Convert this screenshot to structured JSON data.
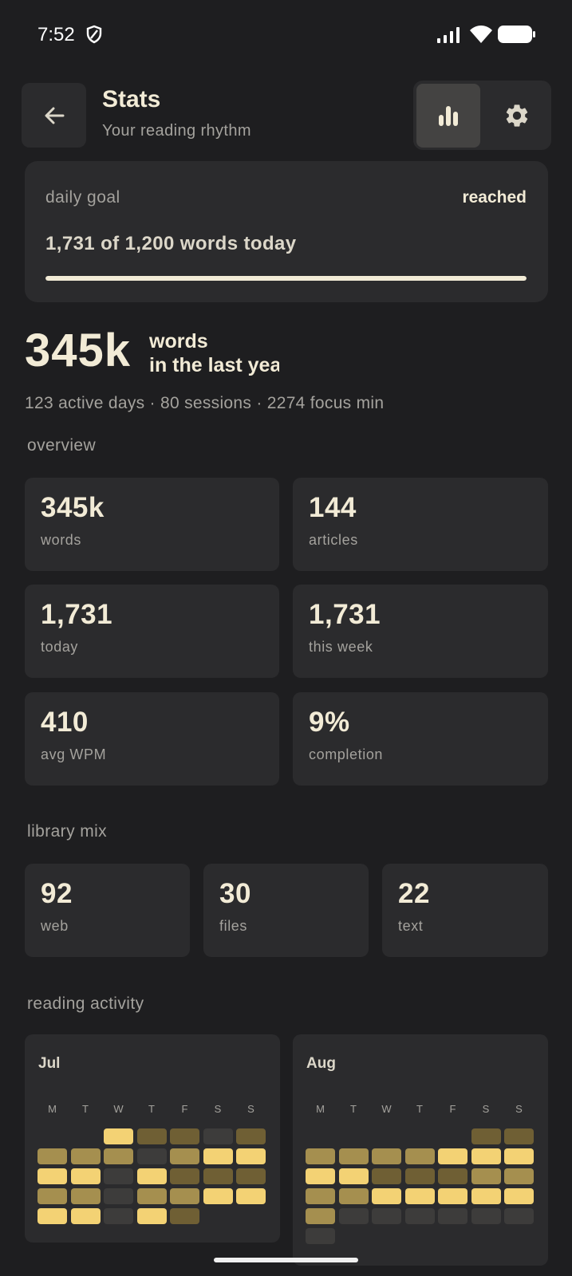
{
  "status_bar": {
    "time": "7:52"
  },
  "header": {
    "title": "Stats",
    "subtitle": "Your reading rhythm"
  },
  "goal": {
    "label": "daily goal",
    "status": "reached",
    "text": "1,731 of 1,200 words today",
    "progress": 1.0
  },
  "totals": {
    "value": "345k",
    "unit": "words",
    "period": "in the last year",
    "summary": "123 active days · 80 sessions · 2274 focus min"
  },
  "overview": {
    "label": "overview",
    "cards": [
      {
        "value": "345k",
        "label": "words"
      },
      {
        "value": "144",
        "label": "articles"
      },
      {
        "value": "1,731",
        "label": "today"
      },
      {
        "value": "1,731",
        "label": "this week"
      },
      {
        "value": "410",
        "label": "avg WPM"
      },
      {
        "value": "9%",
        "label": "completion"
      }
    ]
  },
  "library": {
    "label": "library mix",
    "cards": [
      {
        "value": "92",
        "label": "web"
      },
      {
        "value": "30",
        "label": "files"
      },
      {
        "value": "22",
        "label": "text"
      }
    ]
  },
  "activity": {
    "label": "reading activity",
    "weekdays": [
      "M",
      "T",
      "W",
      "T",
      "F",
      "S",
      "S"
    ],
    "level_colors": [
      "#3d3c3b",
      "#6f5f34",
      "#a58f4f",
      "#f3d274"
    ],
    "months": [
      {
        "name": "Jul",
        "rows": [
          [
            null,
            null,
            3,
            1,
            1,
            0,
            1
          ],
          [
            2,
            2,
            2,
            0,
            2,
            3,
            3
          ],
          [
            3,
            3,
            0,
            3,
            1,
            1,
            1
          ],
          [
            2,
            2,
            0,
            2,
            2,
            3,
            3
          ],
          [
            3,
            3,
            0,
            3,
            1,
            null,
            null
          ]
        ]
      },
      {
        "name": "Aug",
        "rows": [
          [
            null,
            null,
            null,
            null,
            null,
            1,
            1
          ],
          [
            2,
            2,
            2,
            2,
            3,
            3,
            3
          ],
          [
            3,
            3,
            1,
            1,
            1,
            2,
            2
          ],
          [
            2,
            2,
            3,
            3,
            3,
            3,
            3
          ],
          [
            2,
            0,
            0,
            0,
            0,
            0,
            0
          ],
          [
            0,
            null,
            null,
            null,
            null,
            null,
            null
          ]
        ]
      }
    ]
  }
}
